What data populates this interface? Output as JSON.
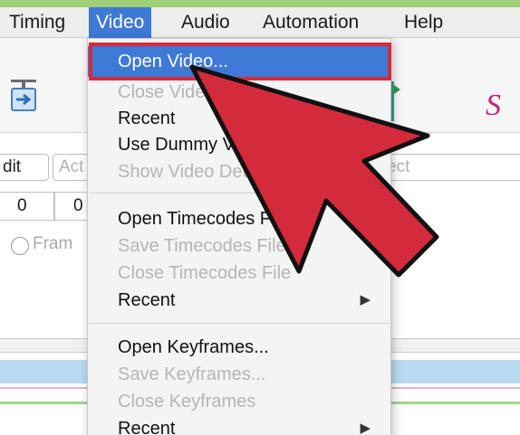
{
  "menubar": {
    "items": [
      {
        "label": "Timing",
        "active": false
      },
      {
        "label": "Video",
        "active": true
      },
      {
        "label": "Audio",
        "active": false
      },
      {
        "label": "Automation",
        "active": false
      },
      {
        "label": "Help",
        "active": false
      }
    ]
  },
  "toolbar": {
    "left_icon": "video-arrow-icon",
    "right_icon": "keyframe-marker-icon",
    "right_glyph": "S"
  },
  "edit_row": {
    "edit_text": "dit",
    "actor_placeholder": "Act",
    "effect_placeholder": "ect"
  },
  "num_row": {
    "values": [
      "0",
      "0"
    ]
  },
  "radio": {
    "label": "Fram"
  },
  "video_menu": {
    "items": [
      {
        "label": "Open Video...",
        "state": "selected"
      },
      {
        "label": "Close Video",
        "state": "disabled"
      },
      {
        "label": "Recent",
        "state": "enabled",
        "submenu": true
      },
      {
        "label": "Use Dummy Video...",
        "state": "enabled"
      },
      {
        "label": "Show Video Details...",
        "state": "disabled"
      },
      {
        "label": "Open Timecodes File...",
        "state": "enabled"
      },
      {
        "label": "Save Timecodes File...",
        "state": "disabled"
      },
      {
        "label": "Close Timecodes File",
        "state": "disabled"
      },
      {
        "label": "Recent",
        "state": "enabled",
        "submenu": true
      },
      {
        "label": "Open Keyframes...",
        "state": "enabled"
      },
      {
        "label": "Save Keyframes...",
        "state": "disabled"
      },
      {
        "label": "Close Keyframes",
        "state": "disabled"
      },
      {
        "label": "Recent",
        "state": "enabled",
        "submenu": true
      }
    ],
    "submenu_arrow": "▶"
  },
  "colors": {
    "accent_green": "#9fcf76",
    "menu_highlight": "#3e79d6",
    "callout_red": "#d42b3c",
    "pane_blue": "#b8daf0"
  }
}
